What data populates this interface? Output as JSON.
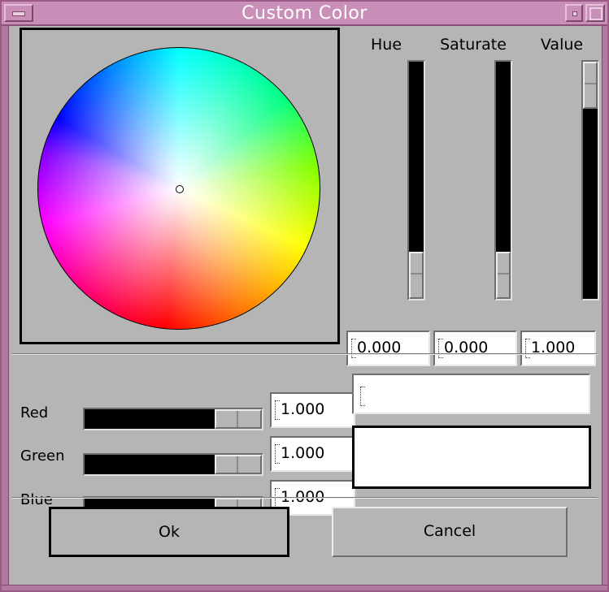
{
  "window": {
    "title": "Custom Color"
  },
  "hsv": {
    "labels": {
      "hue": "Hue",
      "saturate": "Saturate",
      "value": "Value"
    },
    "values": {
      "hue": "0.000",
      "saturate": "0.000",
      "value": "1.000"
    },
    "levels": {
      "hue": 0.0,
      "saturate": 0.0,
      "value": 1.0
    }
  },
  "rgb": {
    "labels": {
      "red": "Red",
      "green": "Green",
      "blue": "Blue"
    },
    "values": {
      "red": "1.000",
      "green": "1.000",
      "blue": "1.000"
    },
    "levels": {
      "red": 1.0,
      "green": 1.0,
      "blue": 1.0
    }
  },
  "color_name": "",
  "swatch_color": "#ffffff",
  "buttons": {
    "ok": "Ok",
    "cancel": "Cancel"
  },
  "icons": [
    "menu-icon",
    "minimize-icon",
    "maximize-icon",
    "caret-icon"
  ]
}
